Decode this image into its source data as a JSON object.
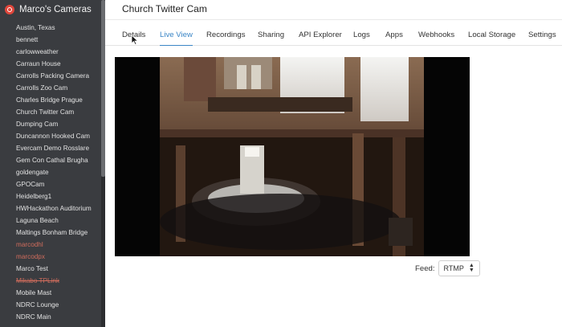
{
  "sidebar": {
    "title": "Marco's Cameras",
    "items": [
      {
        "label": "Austin, Texas",
        "state": "normal"
      },
      {
        "label": "bennett",
        "state": "normal"
      },
      {
        "label": "carlowweather",
        "state": "normal"
      },
      {
        "label": "Carraun House",
        "state": "normal"
      },
      {
        "label": "Carrolls Packing Camera",
        "state": "normal"
      },
      {
        "label": "Carrolls Zoo Cam",
        "state": "normal"
      },
      {
        "label": "Charles Bridge Prague",
        "state": "normal"
      },
      {
        "label": "Church Twitter Cam",
        "state": "normal"
      },
      {
        "label": "Dumping Cam",
        "state": "normal"
      },
      {
        "label": "Duncannon Hooked Cam",
        "state": "normal"
      },
      {
        "label": "Evercam Demo Rosslare",
        "state": "normal"
      },
      {
        "label": "Gem Con Cathal Brugha",
        "state": "normal"
      },
      {
        "label": "goldengate",
        "state": "normal"
      },
      {
        "label": "GPOCam",
        "state": "normal"
      },
      {
        "label": "Heidelberg1",
        "state": "normal"
      },
      {
        "label": "HWHackathon Auditorium",
        "state": "normal"
      },
      {
        "label": "Laguna Beach",
        "state": "normal"
      },
      {
        "label": "Maltings Bonham Bridge",
        "state": "normal"
      },
      {
        "label": "marcodhl",
        "state": "disabled"
      },
      {
        "label": "marcodpx",
        "state": "disabled"
      },
      {
        "label": "Marco Test",
        "state": "normal"
      },
      {
        "label": "Mikabo TPLink",
        "state": "struck"
      },
      {
        "label": "Mobile Mast",
        "state": "normal"
      },
      {
        "label": "NDRC Lounge",
        "state": "normal"
      },
      {
        "label": "NDRC Main",
        "state": "normal"
      }
    ]
  },
  "header": {
    "title": "Church Twitter Cam"
  },
  "tabs": [
    {
      "label": "Details",
      "active": false
    },
    {
      "label": "Live View",
      "active": true
    },
    {
      "label": "Recordings",
      "active": false
    },
    {
      "label": "Sharing",
      "active": false
    },
    {
      "label": "API Explorer",
      "active": false
    },
    {
      "label": "Logs",
      "active": false
    },
    {
      "label": "Apps",
      "active": false
    },
    {
      "label": "Webhooks",
      "active": false
    },
    {
      "label": "Local Storage",
      "active": false
    },
    {
      "label": "Settings",
      "active": false
    }
  ],
  "feed": {
    "label": "Feed:",
    "selected": "RTMP"
  },
  "colors": {
    "accent": "#3b86c6",
    "sidebar_bg": "#3a3c40",
    "disabled_item": "#d06c5c",
    "brand": "#e0463b"
  }
}
